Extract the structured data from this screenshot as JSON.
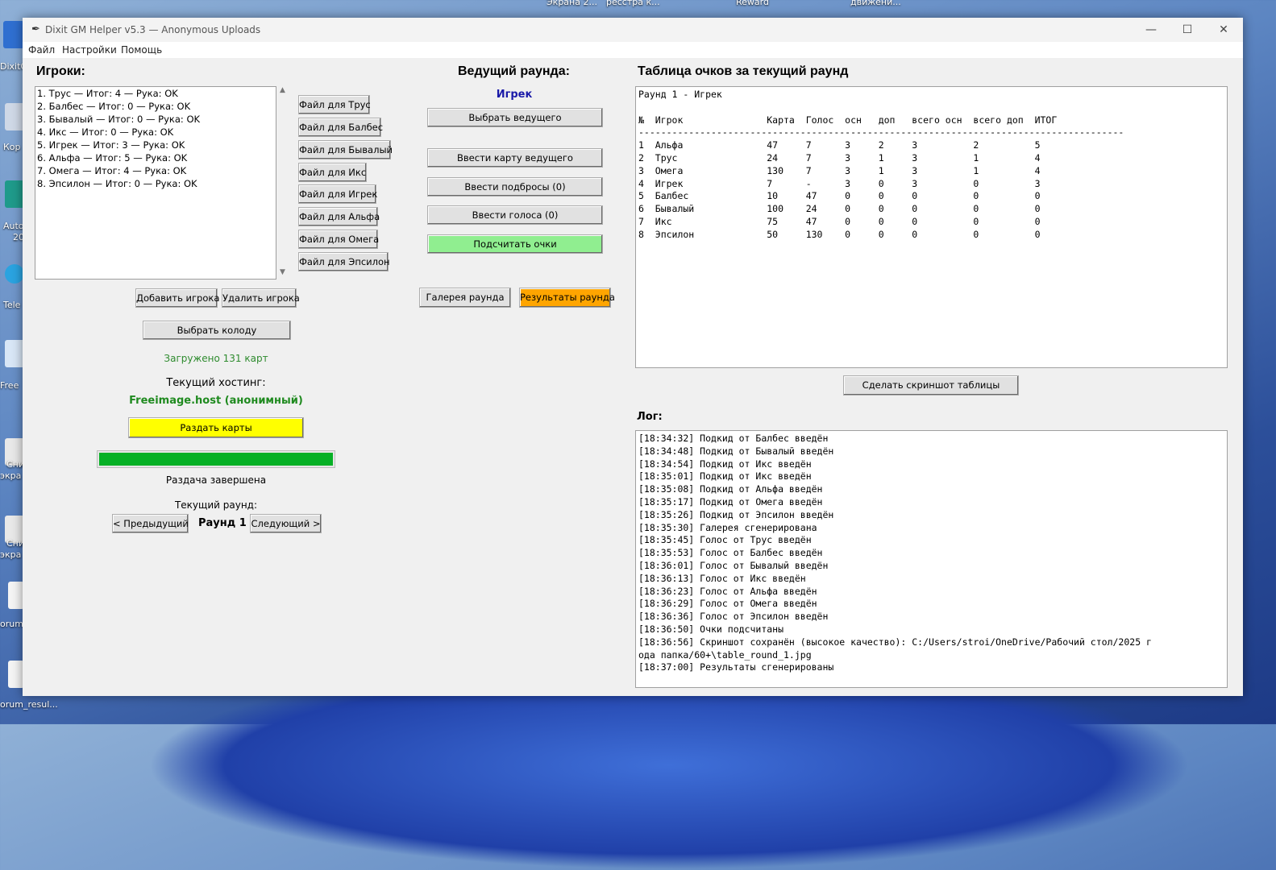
{
  "desktop": {
    "top_labels": [
      "Экрана 2...",
      "ресстра к...",
      "Reward",
      "движени..."
    ],
    "left_labels": [
      "DixitG",
      "Кор",
      "Auto",
      "20",
      "Tele",
      "Free",
      "Сни",
      "экра",
      "Сни",
      "экра",
      "orum"
    ],
    "bottom_label": "orum_resul..."
  },
  "window": {
    "title": "Dixit GM Helper v5.3 — Anonymous Uploads",
    "minimize": "—",
    "maximize": "☐",
    "close": "✕"
  },
  "menu": [
    "Файл",
    "Настройки",
    "Помощь"
  ],
  "players": {
    "heading": "Игроки:",
    "list": [
      "1. Трус — Итог: 4 — Рука: OK",
      "2. Балбес — Итог: 0 — Рука: OK",
      "3. Бывалый — Итог: 0 — Рука: OK",
      "4. Икс — Итог: 0 — Рука: OK",
      "5. Игрек — Итог: 3 — Рука: OK",
      "6. Альфа — Итог: 5 — Рука: OK",
      "7. Омега — Итог: 4 — Рука: OK",
      "8. Эпсилон — Итог: 0 — Рука: OK"
    ],
    "file_buttons": [
      "Файл для Трус",
      "Файл для Балбес",
      "Файл для Бывалый",
      "Файл для Икс",
      "Файл для Игрек",
      "Файл для Альфа",
      "Файл для Омега",
      "Файл для Эпсилон"
    ],
    "add_button": "Добавить игрока",
    "remove_button": "Удалить игрока",
    "choose_deck_button": "Выбрать колоду",
    "loaded_status": "Загружено 131 карт",
    "hosting_label": "Текущий хостинг:",
    "hosting_value": "Freeimage.host (анонимный)",
    "deal_button": "Раздать карты",
    "progress": 1.0,
    "deal_status": "Раздача завершена",
    "round_label": "Текущий раунд:",
    "prev_button": "< Предыдущий",
    "round_value": "Раунд 1",
    "next_button": "Следующий >"
  },
  "leader": {
    "heading": "Ведущий раунда:",
    "name": "Игрек",
    "choose_button": "Выбрать ведущего",
    "enter_card_button": "Ввести карту ведущего",
    "enter_throws_button": "Ввести подбросы (0)",
    "enter_votes_button": "Ввести голоса (0)",
    "count_button": "Подсчитать очки",
    "gallery_button": "Галерея раунда",
    "results_button": "Результаты раунда"
  },
  "score_table": {
    "heading": "Таблица очков за текущий раунд",
    "lines": [
      "Раунд 1 - Игрек",
      "",
      "№  Игрок               Карта  Голос  осн   доп   всего осн  всего доп  ИТОГ",
      "---------------------------------------------------------------------------------------",
      "1  Альфа               47     7      3     2     3          2          5",
      "2  Трус                24     7      3     1     3          1          4",
      "3  Омега               130    7      3     1     3          1          4",
      "4  Игрек               7      -      3     0     3          0          3",
      "5  Балбес              10     47     0     0     0          0          0",
      "6  Бывалый             100    24     0     0     0          0          0",
      "7  Икс                 75     47     0     0     0          0          0",
      "8  Эпсилон             50     130    0     0     0          0          0"
    ],
    "screenshot_button": "Сделать скриншот таблицы"
  },
  "log": {
    "heading": "Лог:",
    "lines": [
      "[18:34:32] Подкид от Балбес введён",
      "[18:34:48] Подкид от Бывалый введён",
      "[18:34:54] Подкид от Икс введён",
      "[18:35:01] Подкид от Икс введён",
      "[18:35:08] Подкид от Альфа введён",
      "[18:35:17] Подкид от Омега введён",
      "[18:35:26] Подкид от Эпсилон введён",
      "[18:35:30] Галерея сгенерирована",
      "[18:35:45] Голос от Трус введён",
      "[18:35:53] Голос от Балбес введён",
      "[18:36:01] Голос от Бывалый введён",
      "[18:36:13] Голос от Икс введён",
      "[18:36:23] Голос от Альфа введён",
      "[18:36:29] Голос от Омега введён",
      "[18:36:36] Голос от Эпсилон введён",
      "[18:36:50] Очки подсчитаны",
      "[18:36:56] Скриншот сохранён (высокое качество): C:/Users/stroi/OneDrive/Рабочий стол/2025 г",
      "ода папка/60+\\table_round_1.jpg",
      "[18:37:00] Результаты сгенерированы"
    ]
  },
  "colors": {
    "leader_name": "#1a1aa8",
    "loaded_status": "#2e8b2e",
    "hosting_value": "#1f8a1f",
    "deal_button": "#ffff00",
    "count_button": "#90ee90",
    "results_button": "#ffa500",
    "progress_fill": "#06b025"
  }
}
